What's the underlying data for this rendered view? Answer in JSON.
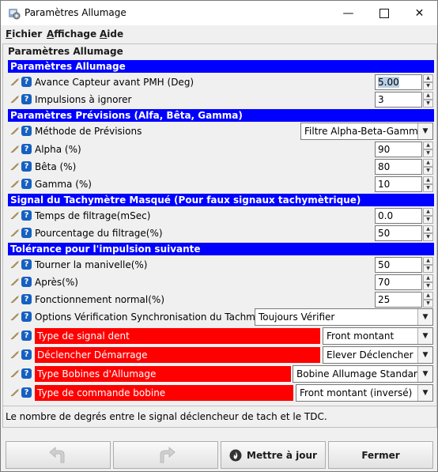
{
  "window": {
    "title": "Paramètres Allumage"
  },
  "menu": [
    {
      "label": "Fichier",
      "mnemonic": "F",
      "rest": "ichier"
    },
    {
      "label": "Affichage",
      "mnemonic": "A",
      "rest": "ffichage"
    },
    {
      "label": "Aide",
      "mnemonic": "A",
      "rest": "ide"
    }
  ],
  "panel": {
    "title": "Paramètres Allumage"
  },
  "sections": [
    {
      "title": "Paramètres Allumage"
    },
    {
      "title": "Paramètres Prévisions (Alfa, Bêta, Gamma)"
    },
    {
      "title": "Signal du Tachymètre Masqué (Pour faux signaux tachymètrique)"
    },
    {
      "title": "Tolérance pour l'impulsion suivante"
    }
  ],
  "rows": [
    {
      "label": "Avance Capteur avant PMH (Deg)",
      "value": "5.00"
    },
    {
      "label": "Impulsions à ignorer",
      "value": "3"
    },
    {
      "label": "Méthode de Prévisions",
      "value": "Filtre Alpha-Beta-Gamma"
    },
    {
      "label": "Alpha (%)",
      "value": "90"
    },
    {
      "label": "Bêta (%)",
      "value": "80"
    },
    {
      "label": "Gamma (%)",
      "value": "10"
    },
    {
      "label": "Temps de filtrage(mSec)",
      "value": "0.0"
    },
    {
      "label": "Pourcentage du filtrage(%)",
      "value": "50"
    },
    {
      "label": "Tourner la manivelle(%)",
      "value": "50"
    },
    {
      "label": "Après(%)",
      "value": "70"
    },
    {
      "label": "Fonctionnement normal(%)",
      "value": "25"
    },
    {
      "label": "Options Vérification Synchronisation du Tachmètre",
      "value": "Toujours Vérifier"
    },
    {
      "label": "Type de signal dent",
      "value": "Front montant"
    },
    {
      "label": "Déclencher Démarrage",
      "value": "Elever Déclencher"
    },
    {
      "label": "Type Bobines d'Allumage",
      "value": "Bobine Allumage Standard"
    },
    {
      "label": "Type de commande bobine",
      "value": "Front montant (inversé)"
    }
  ],
  "status": {
    "text": "Le nombre de degrés entre le signal déclencheur de tach et le TDC."
  },
  "buttons": {
    "update": "Mettre à jour",
    "close": "Fermer"
  },
  "colors": {
    "section_bg": "#0000ff",
    "warning_bg": "#ff0000",
    "help_icon": "#1560c0"
  }
}
